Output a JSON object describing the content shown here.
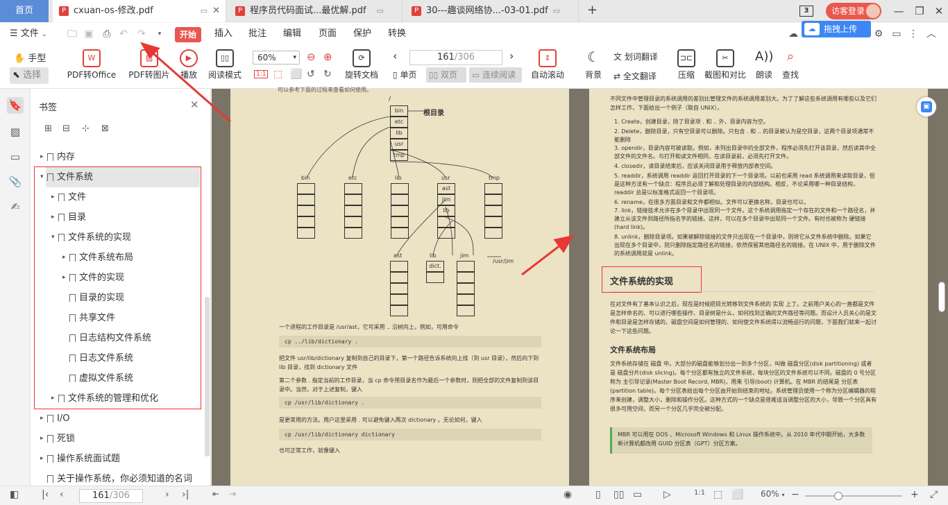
{
  "tabs": {
    "home": "首页",
    "items": [
      {
        "label": "cxuan-os-修改.pdf"
      },
      {
        "label": "程序员代码面试...最优解.pdf"
      },
      {
        "label": "30---趣谈网络协...-03-01.pdf"
      }
    ],
    "new_tab": "+",
    "tab_count": "3",
    "login": "访客登录"
  },
  "menubar": {
    "file": "文件",
    "start": "开始",
    "items": [
      "插入",
      "批注",
      "编辑",
      "页面",
      "保护",
      "转换"
    ],
    "share": "分享",
    "upload": "拖拽上传"
  },
  "ribbon": {
    "hand": "手型",
    "select": "选择",
    "pdf_to_office": "PDF转Office",
    "pdf_to_image": "PDF转图片",
    "play": "播放",
    "read_mode": "阅读模式",
    "zoom_value": "60%",
    "rotate_doc": "旋转文档",
    "page_current": "161",
    "page_total": "/306",
    "single_page": "单页",
    "double_page": "双页",
    "continuous": "连续阅读",
    "auto_scroll": "自动滚动",
    "background": "背景",
    "word_translate": "划词翻译",
    "full_translate": "全文翻译",
    "compress": "压缩",
    "screenshot_compare": "截图和对比",
    "read_aloud": "朗读",
    "find": "查找"
  },
  "bookmarks": {
    "title": "书签",
    "items": [
      {
        "label": "内存"
      },
      {
        "label": "文件系统"
      },
      {
        "label": "文件"
      },
      {
        "label": "目录"
      },
      {
        "label": "文件系统的实现"
      },
      {
        "label": "文件系统布局"
      },
      {
        "label": "文件的实现"
      },
      {
        "label": "目录的实现"
      },
      {
        "label": "共享文件"
      },
      {
        "label": "日志结构文件系统"
      },
      {
        "label": "日志文件系统"
      },
      {
        "label": "虚拟文件系统"
      },
      {
        "label": "文件系统的管理和优化"
      },
      {
        "label": "I/O"
      },
      {
        "label": "死锁"
      },
      {
        "label": "操作系统面试题"
      },
      {
        "label": "关于操作系统，你必须知道的名词"
      }
    ]
  },
  "left_page": {
    "top_cut": "可以参考下面的过程来查看如何使用。",
    "root_label": "根目录",
    "root_entries": [
      "bin",
      "etc",
      "lib",
      "usr",
      "tmp"
    ],
    "slash": "/",
    "columns": [
      "bin",
      "etc",
      "lib",
      "usr",
      "tmp"
    ],
    "usr_entries": [
      "ast",
      "jim",
      "lib"
    ],
    "sub_columns": [
      "ast",
      "lib",
      "jim"
    ],
    "dict": "dict.",
    "usr_jim": "/usr/jim",
    "p1": "一个进程的工作目录是 /usr/ast，它可采用 .. 沿树向上，例如，可用命令",
    "code1": "cp ../lib/dictionary .",
    "p2": "把文件 usr/lib/dictionary 复制到自己的目录下，第一个路径告诉系统向上找（到 usr 目录），然后向下到 lib 目录，找到 dictionary 文件",
    "p3": "第二个参数 . 指定当前的工作目录，当 cp 命令用目录名作为最后一个参数时，则把全部的文件复制到该目录中。当然，对于上述复制，键入",
    "code2": "cp /usr/lib/dictionary .",
    "p4": "是更常用的方法。用户这里采用 . 可以避免键入两次 dictionary 。无论如何，键入",
    "code3": "cp /usr/lib/dictionary dictionary",
    "p5": "也可正常工作，就像键入"
  },
  "right_page": {
    "intro": "不同文件中管理目录的系统调用的差别比管理文件的系统调用差别大。为了了解这些系统调用有哪些以及它们怎样工作，下面给出一个例子（取自 UNIX）。",
    "list": [
      "Create，创建目录，除了目录项 . 和 .. 外，目录内容为空。",
      "Delete，删除目录，只有空目录可以删除。只包含 . 和 .. 的目录被认为是空目录，这两个目录项通常不能删除",
      "opendir，目录内容可被读取。例如，未列出目录中的全部文件，程序必须先打开该目录，然后读其中全部文件的文件名。与打开和读文件相同，在读目录前，必须先打开文件。",
      "closedir，读目录结束后，应该关闭目录用于释放内部表空间。",
      "readdir，系统调用 readdir 返回打开目录的下一个目录项。以前也采用 read 系统调用来读取目录，但是这种方法有一个缺点：程序员必须了解和处理目录的内部结构。相反，不论采用哪一种目录结构，readdir 总是以标准格式返回一个目录项。",
      "rename，在很多方面目录和文件都相似。文件可以更换名称，目录也可以。",
      "link，链接技术允许在多个目录中出现同一个文件。这个系统调用指定一个存在的文件和一个路径名，并建立从该文件到路径所指名字的链接。这样，可以在多个目录中出现同一个文件。有时也被称为 硬链接(hard link)。",
      "unlink，删除目录项。如果被解除链接的文件只出现在一个目录中，则将它从文件系统中删除。如果它出现在多个目录中，则只删除指定路径名的链接，依然保留其他路径名的链接。在 UNIX 中，用于删除文件的系统调用就是 unlink。"
    ],
    "h1": "文件系统的实现",
    "p1": "在对文件有了基本认识之后，现在是时候把目光转移到文件系统的 实现 上了。之前用户关心的一直都是文件是怎样命名的、可以进行哪些操作、目录树是什么，如何找到正确的文件路径等问题。而设计人员关心的是文件和目录是怎样存储的、磁盘空间是如何管理的、如何使文件系统得以流畅运行的问题，下面我们就来一起讨论一下这些问题。",
    "h2": "文件系统布局",
    "p2": "文件系统存储在 磁盘 中。大部分的磁盘能够划分出一到多个分区，叫做 磁盘分区(disk partitioning) 或者是 磁盘分片(disk slicing)。每个分区都有独立的文件系统，每块分区的文件系统可以不同。磁盘的 0 号分区称为 主引导记录(Master Boot Record, MBR)，用来 引导(boot) 计算机。在 MBR 的结尾是 分区表(partition table)。每个分区表给出每个分区由开始到结束的地址。系统管理员使用一个称为分区编辑器的程序来创建，调整大小，删除和操作分区。这种方式的一个缺点是很难适当调整分区的大小，导致一个分区具有很多可用空间，而另一个分区几乎完全被分配。",
    "note": "MBR 可以用在 DOS 、Microsoft Windows 和 Linux 操作系统中。从 2010 年代中期开始，大多数新计算机都改用 GUID 分区表（GPT）分区方案。"
  },
  "status": {
    "page_current": "161",
    "page_total": "/306",
    "zoom": "60%"
  },
  "colors": {
    "accent": "#e9574f",
    "annotation": "#e53935",
    "page_bg": "#ece2c4"
  }
}
